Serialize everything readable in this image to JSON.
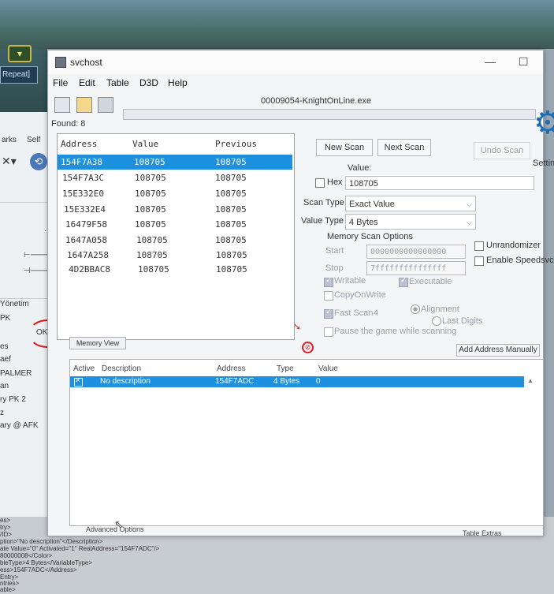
{
  "background": {
    "repeat_label": "Repeat]",
    "left_panel": {
      "tabs": [
        "arks",
        "Self"
      ],
      "items": [
        "Yönetim",
        "PK",
        "es",
        "aef",
        "PALMER",
        "an",
        "ry PK 2",
        "z",
        "ary @ AFK"
      ],
      "okn_label": "OKN"
    },
    "xml_lines": [
      "es>",
      "try>",
      "/ID>",
      "ption>\"No description\"</Description>",
      "ate Value=\"0\" Activated=\"1\" RealAddress=\"154F7ADC\"/>",
      "80000008</Color>",
      "bleType>4 Bytes</VariableType>",
      "ess>154F7ADC</Address>",
      "Entry>",
      "ntries>",
      "able>"
    ]
  },
  "window": {
    "title": "svchost",
    "menu": [
      "File",
      "Edit",
      "Table",
      "D3D",
      "Help"
    ],
    "process": "00009054-KnightOnLine.exe",
    "found_label": "Found: 8",
    "results": {
      "headers": [
        "Address",
        "Value",
        "Previous"
      ],
      "rows": [
        {
          "address": "154F7A38",
          "value": "108705",
          "previous": "108705"
        },
        {
          "address": "154F7A3C",
          "value": "108705",
          "previous": "108705"
        },
        {
          "address": "15E332E0",
          "value": "108705",
          "previous": "108705"
        },
        {
          "address": "15E332E4",
          "value": "108705",
          "previous": "108705"
        },
        {
          "address": "16479F58",
          "value": "108705",
          "previous": "108705"
        },
        {
          "address": "1647A058",
          "value": "108705",
          "previous": "108705"
        },
        {
          "address": "1647A258",
          "value": "108705",
          "previous": "108705"
        },
        {
          "address": "4D2BBAC8",
          "value": "108705",
          "previous": "108705"
        }
      ],
      "selected_index": 0
    },
    "memory_view_label": "Memory View",
    "scan": {
      "new_scan": "New Scan",
      "next_scan": "Next Scan",
      "undo_scan": "Undo Scan",
      "settings": "Settin",
      "value_label": "Value:",
      "hex_label": "Hex",
      "value": "108705",
      "scan_type_label": "Scan Type",
      "scan_type": "Exact Value",
      "value_type_label": "Value Type",
      "value_type": "4 Bytes",
      "memory_scan_options": "Memory Scan Options",
      "start_label": "Start",
      "start": "0000000000000000",
      "stop_label": "Stop",
      "stop": "7fffffffffffffff",
      "writable": "Writable",
      "executable": "Executable",
      "copy_on_write": "CopyOnWrite",
      "fast_scan": "Fast Scan",
      "fast_scan_value": "4",
      "alignment": "Alignment",
      "last_digits": "Last Digits",
      "pause_game": "Pause the game while scanning",
      "unrandomizer": "Unrandomizer",
      "enable_speedhack": "Enable Speedsvch",
      "add_address": "Add Address Manually"
    },
    "address_table": {
      "headers": [
        "Active",
        "Description",
        "Address",
        "Type",
        "Value"
      ],
      "rows": [
        {
          "description": "No description",
          "address": "154F7ADC",
          "type": "4 Bytes",
          "value": "0"
        }
      ]
    },
    "advanced_options": "Advanced Options",
    "table_extras": "Table Extras"
  }
}
